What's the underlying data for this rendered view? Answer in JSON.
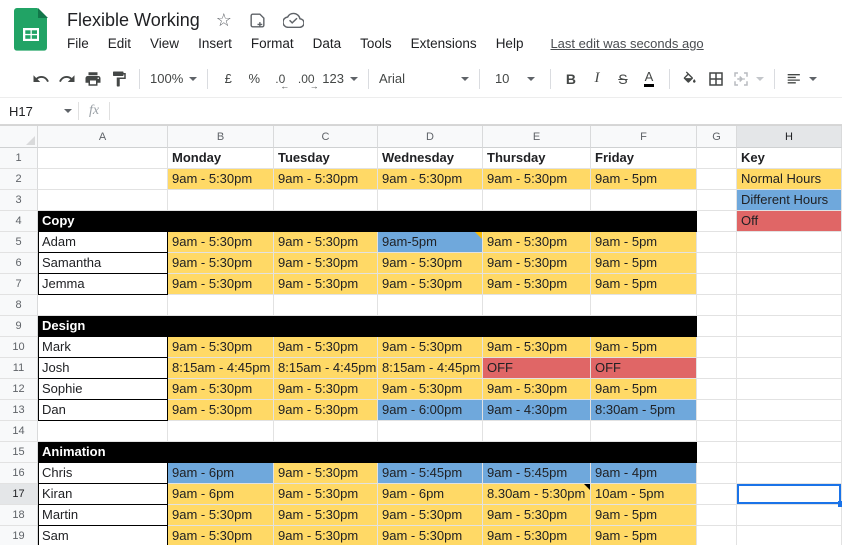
{
  "app": {
    "title": "Flexible Working",
    "menus": [
      "File",
      "Edit",
      "View",
      "Insert",
      "Format",
      "Data",
      "Tools",
      "Extensions",
      "Help"
    ],
    "last_edit": "Last edit was seconds ago",
    "title_icons": [
      "star-icon",
      "add-shortcut-icon",
      "cloud-saved-icon"
    ],
    "icons": {
      "star": "☆"
    }
  },
  "toolbar": {
    "zoom": "100%",
    "currency": "£",
    "percent": "%",
    "decimal_decrease": ".0",
    "decimal_increase": ".00",
    "number_format": "123",
    "font": "Arial",
    "font_size": "10",
    "bold": "B",
    "italic": "I",
    "strikethrough": "S",
    "text_color": "A",
    "icon_buttons": [
      "undo-icon",
      "redo-icon",
      "print-icon",
      "paint-format-icon",
      "fill-color-icon",
      "borders-icon",
      "merge-cells-icon",
      "horizontal-align-icon"
    ]
  },
  "formula_bar": {
    "name_box": "H17",
    "fx": "fx",
    "formula": ""
  },
  "colors": {
    "normal_hours": "#FFD966",
    "different_hours": "#6FA8DC",
    "off": "#E06666",
    "section_header": "#000000",
    "selection": "#1A73E8",
    "logo_green": "#21A365"
  },
  "grid": {
    "column_headers": [
      "A",
      "B",
      "C",
      "D",
      "E",
      "F",
      "G",
      "H"
    ],
    "selected_cell": "H17",
    "selected_column": "H",
    "selected_row": 17,
    "rows": [
      {
        "n": 1,
        "cells": {
          "B": {
            "t": "Monday",
            "b": 1
          },
          "C": {
            "t": "Tuesday",
            "b": 1
          },
          "D": {
            "t": "Wednesday",
            "b": 1
          },
          "E": {
            "t": "Thursday",
            "b": 1
          },
          "F": {
            "t": "Friday",
            "b": 1
          },
          "H": {
            "t": "Key",
            "b": 1
          }
        }
      },
      {
        "n": 2,
        "cells": {
          "B": {
            "t": "9am - 5:30pm",
            "bg": "y"
          },
          "C": {
            "t": "9am - 5:30pm",
            "bg": "y"
          },
          "D": {
            "t": "9am - 5:30pm",
            "bg": "y"
          },
          "E": {
            "t": "9am - 5:30pm",
            "bg": "y"
          },
          "F": {
            "t": "9am - 5pm",
            "bg": "y"
          },
          "H": {
            "t": "Normal Hours",
            "bg": "y"
          }
        }
      },
      {
        "n": 3,
        "cells": {
          "H": {
            "t": "Different Hours",
            "bg": "b"
          }
        }
      },
      {
        "n": 4,
        "cells": {
          "A": {
            "t": "Copy",
            "bg": "k",
            "b": 1,
            "w": 1
          },
          "B": {
            "bg": "k"
          },
          "C": {
            "bg": "k"
          },
          "D": {
            "bg": "k"
          },
          "E": {
            "bg": "k"
          },
          "F": {
            "bg": "k"
          },
          "H": {
            "t": "Off",
            "bg": "r"
          }
        }
      },
      {
        "n": 5,
        "cells": {
          "A": {
            "t": "Adam",
            "nb": 1
          },
          "B": {
            "t": "9am - 5:30pm",
            "bg": "y"
          },
          "C": {
            "t": "9am - 5:30pm",
            "bg": "y"
          },
          "D": {
            "t": "9am-5pm",
            "bg": "b",
            "note": "orange"
          },
          "E": {
            "t": "9am - 5:30pm",
            "bg": "y"
          },
          "F": {
            "t": "9am - 5pm",
            "bg": "y"
          }
        }
      },
      {
        "n": 6,
        "cells": {
          "A": {
            "t": "Samantha",
            "nb": 1
          },
          "B": {
            "t": "9am - 5:30pm",
            "bg": "y"
          },
          "C": {
            "t": "9am - 5:30pm",
            "bg": "y"
          },
          "D": {
            "t": "9am - 5:30pm",
            "bg": "y"
          },
          "E": {
            "t": "9am - 5:30pm",
            "bg": "y"
          },
          "F": {
            "t": "9am - 5pm",
            "bg": "y"
          }
        }
      },
      {
        "n": 7,
        "cells": {
          "A": {
            "t": "Jemma",
            "nb": 1
          },
          "B": {
            "t": "9am - 5:30pm",
            "bg": "y"
          },
          "C": {
            "t": "9am - 5:30pm",
            "bg": "y"
          },
          "D": {
            "t": "9am - 5:30pm",
            "bg": "y"
          },
          "E": {
            "t": "9am - 5:30pm",
            "bg": "y"
          },
          "F": {
            "t": "9am - 5pm",
            "bg": "y"
          }
        }
      },
      {
        "n": 8,
        "cells": {}
      },
      {
        "n": 9,
        "cells": {
          "A": {
            "t": "Design",
            "bg": "k",
            "b": 1,
            "w": 1
          },
          "B": {
            "bg": "k"
          },
          "C": {
            "bg": "k"
          },
          "D": {
            "bg": "k"
          },
          "E": {
            "bg": "k"
          },
          "F": {
            "bg": "k"
          }
        }
      },
      {
        "n": 10,
        "cells": {
          "A": {
            "t": "Mark",
            "nb": 1
          },
          "B": {
            "t": "9am - 5:30pm",
            "bg": "y"
          },
          "C": {
            "t": "9am - 5:30pm",
            "bg": "y"
          },
          "D": {
            "t": "9am - 5:30pm",
            "bg": "y"
          },
          "E": {
            "t": "9am - 5:30pm",
            "bg": "y"
          },
          "F": {
            "t": "9am - 5pm",
            "bg": "y"
          }
        }
      },
      {
        "n": 11,
        "cells": {
          "A": {
            "t": "Josh",
            "nb": 1
          },
          "B": {
            "t": "8:15am - 4:45pm",
            "bg": "y"
          },
          "C": {
            "t": "8:15am - 4:45pm",
            "bg": "y"
          },
          "D": {
            "t": "8:15am - 4:45pm",
            "bg": "y"
          },
          "E": {
            "t": "OFF",
            "bg": "r"
          },
          "F": {
            "t": "OFF",
            "bg": "r"
          }
        }
      },
      {
        "n": 12,
        "cells": {
          "A": {
            "t": "Sophie",
            "nb": 1
          },
          "B": {
            "t": "9am - 5:30pm",
            "bg": "y"
          },
          "C": {
            "t": "9am - 5:30pm",
            "bg": "y"
          },
          "D": {
            "t": "9am - 5:30pm",
            "bg": "y"
          },
          "E": {
            "t": "9am - 5:30pm",
            "bg": "y"
          },
          "F": {
            "t": "9am - 5pm",
            "bg": "y"
          }
        }
      },
      {
        "n": 13,
        "cells": {
          "A": {
            "t": "Dan",
            "nb": 1
          },
          "B": {
            "t": "9am - 5:30pm",
            "bg": "y"
          },
          "C": {
            "t": "9am - 5:30pm",
            "bg": "y"
          },
          "D": {
            "t": "9am - 6:00pm",
            "bg": "b"
          },
          "E": {
            "t": "9am - 4:30pm",
            "bg": "b"
          },
          "F": {
            "t": "8:30am - 5pm",
            "bg": "b"
          }
        }
      },
      {
        "n": 14,
        "cells": {}
      },
      {
        "n": 15,
        "cells": {
          "A": {
            "t": "Animation",
            "bg": "k",
            "b": 1,
            "w": 1
          },
          "B": {
            "bg": "k"
          },
          "C": {
            "bg": "k"
          },
          "D": {
            "bg": "k"
          },
          "E": {
            "bg": "k"
          },
          "F": {
            "bg": "k"
          }
        }
      },
      {
        "n": 16,
        "cells": {
          "A": {
            "t": "Chris",
            "nb": 1
          },
          "B": {
            "t": "9am - 6pm",
            "bg": "b"
          },
          "C": {
            "t": "9am - 5:30pm",
            "bg": "y"
          },
          "D": {
            "t": "9am - 5:45pm",
            "bg": "b"
          },
          "E": {
            "t": "9am - 5:45pm",
            "bg": "b"
          },
          "F": {
            "t": "9am - 4pm",
            "bg": "b"
          }
        }
      },
      {
        "n": 17,
        "cells": {
          "A": {
            "t": "Kiran",
            "nb": 1
          },
          "B": {
            "t": "9am - 6pm",
            "bg": "y"
          },
          "C": {
            "t": "9am - 5:30pm",
            "bg": "y"
          },
          "D": {
            "t": "9am - 6pm",
            "bg": "y"
          },
          "E": {
            "t": "8.30am - 5:30pm",
            "bg": "y",
            "note": "black"
          },
          "F": {
            "t": "10am - 5pm",
            "bg": "y"
          },
          "H": {
            "sel": 1
          }
        }
      },
      {
        "n": 18,
        "cells": {
          "A": {
            "t": "Martin",
            "nb": 1
          },
          "B": {
            "t": "9am - 5:30pm",
            "bg": "y"
          },
          "C": {
            "t": "9am - 5:30pm",
            "bg": "y"
          },
          "D": {
            "t": "9am - 5:30pm",
            "bg": "y"
          },
          "E": {
            "t": "9am - 5:30pm",
            "bg": "y"
          },
          "F": {
            "t": "9am - 5pm",
            "bg": "y"
          }
        }
      },
      {
        "n": 19,
        "cells": {
          "A": {
            "t": "Sam",
            "nb": 1
          },
          "B": {
            "t": "9am - 5:30pm",
            "bg": "y"
          },
          "C": {
            "t": "9am - 5:30pm",
            "bg": "y"
          },
          "D": {
            "t": "9am - 5:30pm",
            "bg": "y"
          },
          "E": {
            "t": "9am - 5:30pm",
            "bg": "y"
          },
          "F": {
            "t": "9am - 5pm",
            "bg": "y"
          }
        }
      }
    ]
  }
}
